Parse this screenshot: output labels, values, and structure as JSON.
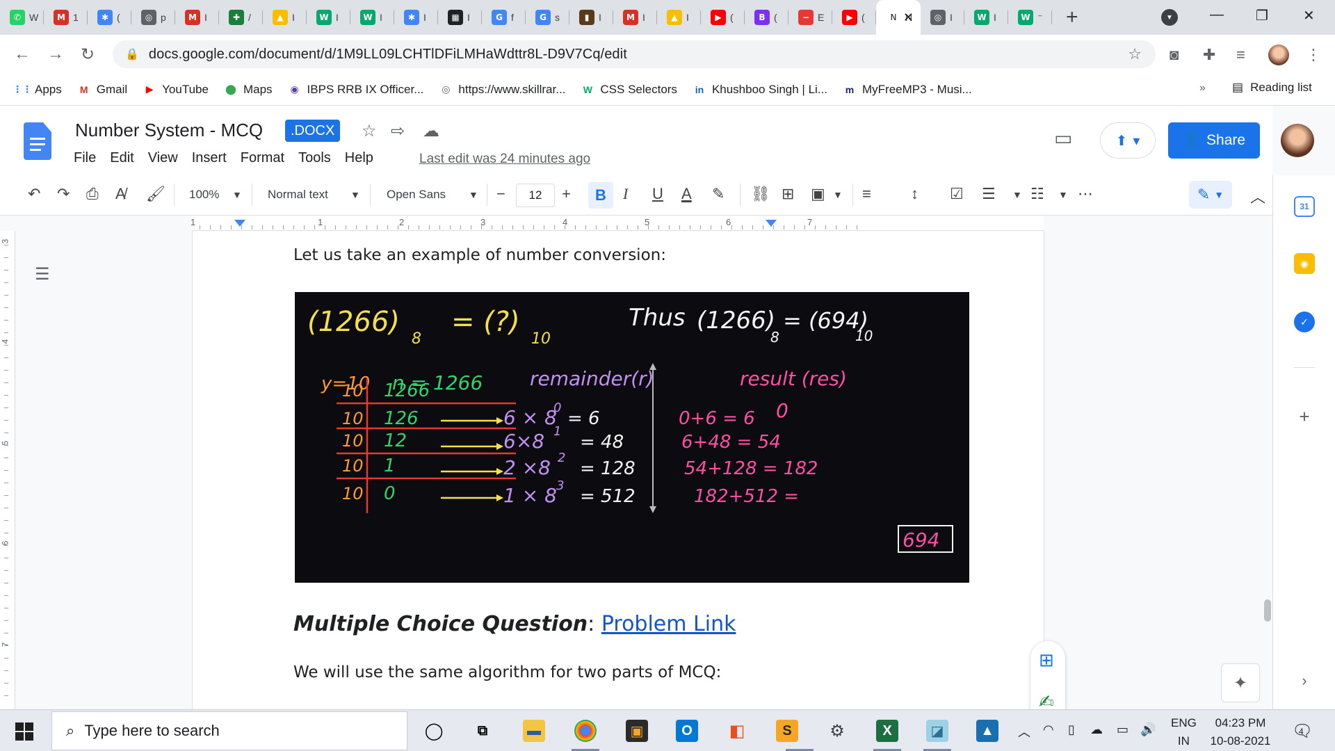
{
  "browser": {
    "tabs": [
      {
        "label": "W",
        "icon": "whatsapp-icon",
        "color": "#25d366",
        "glyph": "✆"
      },
      {
        "label": "1",
        "icon": "gmail-icon",
        "color": "#d93025",
        "glyph": "M"
      },
      {
        "label": "(",
        "icon": "multicolor-icon",
        "color": "#4285f4",
        "glyph": "✱"
      },
      {
        "label": "p",
        "icon": "globe-icon",
        "color": "#5f6368",
        "glyph": "◎"
      },
      {
        "label": "I",
        "icon": "gmail-icon",
        "color": "#d93025",
        "glyph": "M"
      },
      {
        "label": "/",
        "icon": "sheets-plus-icon",
        "color": "#188038",
        "glyph": "✚"
      },
      {
        "label": "I",
        "icon": "drive-icon",
        "color": "#fbbc04",
        "glyph": "▲"
      },
      {
        "label": "I",
        "icon": "w3schools-icon",
        "color": "#04aa6d",
        "glyph": "W"
      },
      {
        "label": "I",
        "icon": "w3schools-icon",
        "color": "#04aa6d",
        "glyph": "W"
      },
      {
        "label": "I",
        "icon": "multicolor-icon",
        "color": "#4285f4",
        "glyph": "✱"
      },
      {
        "label": "I",
        "icon": "calculator-icon",
        "color": "#202124",
        "glyph": "▦"
      },
      {
        "label": "f",
        "icon": "google-icon",
        "color": "#4285f4",
        "glyph": "G"
      },
      {
        "label": "s",
        "icon": "google-icon",
        "color": "#4285f4",
        "glyph": "G"
      },
      {
        "label": "I",
        "icon": "image-icon",
        "color": "#5b3a1a",
        "glyph": "▮"
      },
      {
        "label": "I",
        "icon": "gmail-icon",
        "color": "#d93025",
        "glyph": "M"
      },
      {
        "label": "I",
        "icon": "drive-icon",
        "color": "#fbbc04",
        "glyph": "▲"
      },
      {
        "label": "(",
        "icon": "youtube-icon",
        "color": "#ff0000",
        "glyph": "▶"
      },
      {
        "label": "(",
        "icon": "b-icon",
        "color": "#7b2ff7",
        "glyph": "B"
      },
      {
        "label": "E",
        "icon": "stop-icon",
        "color": "#e53935",
        "glyph": "−"
      },
      {
        "label": "(",
        "icon": "youtube-icon",
        "color": "#ff0000",
        "glyph": "▶"
      },
      {
        "label": "N",
        "icon": "tab-text-icon",
        "color": "#ffffff",
        "glyph": "N",
        "active": true
      },
      {
        "label": "I",
        "icon": "globe-icon",
        "color": "#5f6368",
        "glyph": "◎"
      },
      {
        "label": "I",
        "icon": "w3schools-icon",
        "color": "#04aa6d",
        "glyph": "W"
      },
      {
        "label": "⁻",
        "icon": "w3schools-icon",
        "color": "#04aa6d",
        "glyph": "W"
      }
    ],
    "url": "docs.google.com/document/d/1M9LL09LCHTlDFiLMHaWdttr8L-D9V7Cq/edit",
    "bookmarks": [
      {
        "label": "Apps",
        "icon": "apps-grid-icon",
        "color": "#4285f4",
        "glyph": "⋮⋮"
      },
      {
        "label": "Gmail",
        "icon": "gmail-icon",
        "color": "#d93025",
        "glyph": "M"
      },
      {
        "label": "YouTube",
        "icon": "youtube-icon",
        "color": "#ff0000",
        "glyph": "▶"
      },
      {
        "label": "Maps",
        "icon": "maps-pin-icon",
        "color": "#34a853",
        "glyph": "⬤"
      },
      {
        "label": "IBPS RRB IX Officer...",
        "icon": "ibps-icon",
        "color": "#5b3fa0",
        "glyph": "◉"
      },
      {
        "label": "https://www.skillrar...",
        "icon": "globe-icon",
        "color": "#5f6368",
        "glyph": "◎"
      },
      {
        "label": "CSS Selectors",
        "icon": "w3schools-icon",
        "color": "#04aa6d",
        "glyph": "W"
      },
      {
        "label": "Khushboo Singh | Li...",
        "icon": "linkedin-icon",
        "color": "#0a66c2",
        "glyph": "in"
      },
      {
        "label": "MyFreeMP3 - Musi...",
        "icon": "mp3-icon",
        "color": "#1a237e",
        "glyph": "m"
      }
    ],
    "bookmarks_more": "»",
    "reading_list": "Reading list"
  },
  "docs": {
    "title": "Number System - MCQ",
    "badge": ".DOCX",
    "menus": [
      "File",
      "Edit",
      "View",
      "Insert",
      "Format",
      "Tools",
      "Help"
    ],
    "last_edit": "Last edit was 24 minutes ago",
    "share": "Share",
    "toolbar": {
      "zoom": "100%",
      "style": "Normal text",
      "font": "Open Sans",
      "font_size": "12"
    }
  },
  "ruler": {
    "h_numbers": [
      "1",
      "1",
      "2",
      "3",
      "4",
      "5",
      "6",
      "7"
    ],
    "v_numbers": [
      "3",
      "4",
      "5",
      "6",
      "7"
    ]
  },
  "content": {
    "intro": "Let us take an example of number conversion:",
    "mcq_label": "Multiple Choice Question",
    "mcq_sep": ": ",
    "mcq_link": "Problem Link",
    "next": "We will use the same algorithm for two parts of MCQ:"
  },
  "board": {
    "equation_left": "(1266)",
    "equation_left_base": "8",
    "equation_mid": "= (?)",
    "equation_mid_base": "10",
    "thus": "Thus",
    "thus_eq": "(1266)",
    "thus_eq_base": "8",
    "thus_result": "= (694)",
    "thus_result_base": "10",
    "y_label": "y=10",
    "n_label": "n = 1266",
    "remainder_label": "remainder(r)",
    "result_label": "result (res)",
    "result_init": "0",
    "divisors": [
      "10",
      "10",
      "10",
      "10",
      "10"
    ],
    "quotients": [
      "1266",
      "126",
      "12",
      "1",
      "0"
    ],
    "terms": [
      "6 × 8",
      "6×8",
      "2 ×8",
      "1 × 8"
    ],
    "exps": [
      "0",
      "1",
      "2",
      "3"
    ],
    "term_values": [
      "= 6",
      "= 48",
      "= 128",
      "= 512"
    ],
    "sums": [
      "0+6 = 6",
      "6+48 = 54",
      "54+128 = 182",
      "182+512 ="
    ],
    "final": "694"
  },
  "taskbar": {
    "search_placeholder": "Type here to search",
    "lang_top": "ENG",
    "lang_bottom": "IN",
    "time": "04:23 PM",
    "date": "10-08-2021",
    "notifications": "4"
  }
}
